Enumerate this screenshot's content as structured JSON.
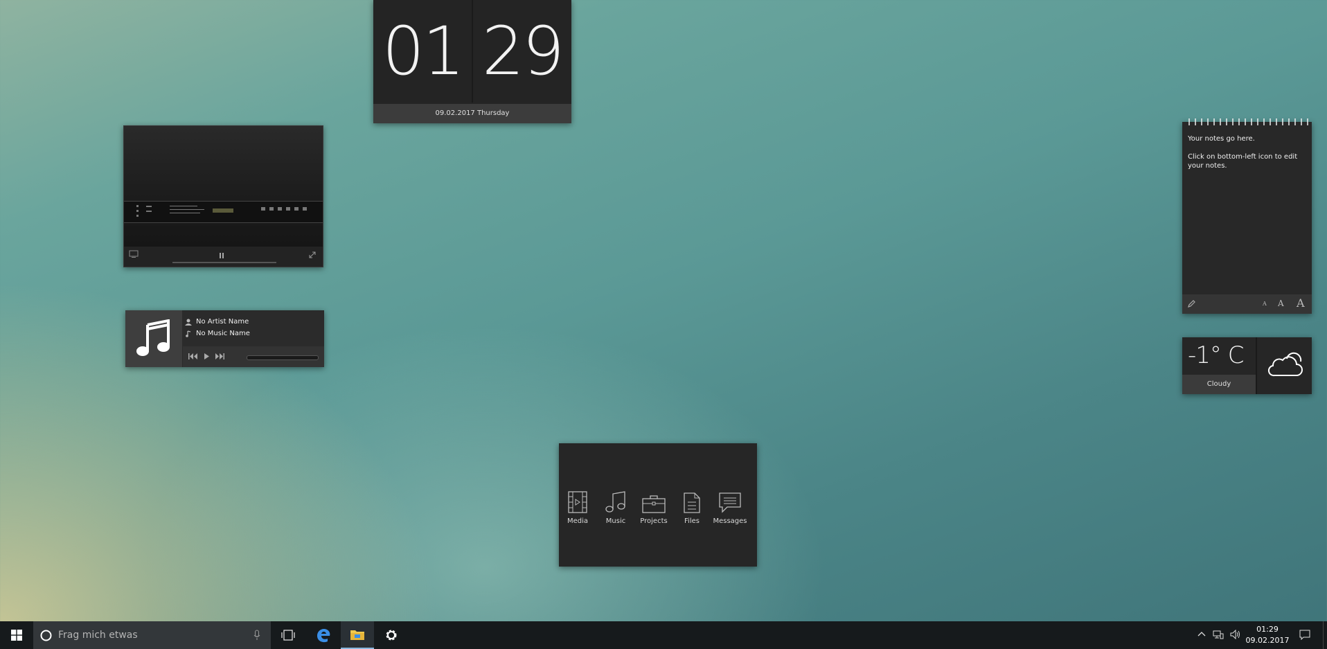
{
  "clock": {
    "hours": "01",
    "minutes": "29",
    "date": "09.02.2017 Thursday"
  },
  "music": {
    "artist": "No Artist Name",
    "title": "No Music Name"
  },
  "notes": {
    "line1": "Your notes go here.",
    "line2": "Click on bottom-left icon to edit your notes.",
    "font_small": "A",
    "font_medium": "A",
    "font_large": "A"
  },
  "weather": {
    "temperature": "-1° C",
    "condition": "Cloudy",
    "icon": "cloud-icon"
  },
  "launcher": {
    "items": [
      {
        "label": "Media",
        "icon": "film-icon"
      },
      {
        "label": "Music",
        "icon": "music-note-icon"
      },
      {
        "label": "Projects",
        "icon": "briefcase-icon"
      },
      {
        "label": "Files",
        "icon": "file-icon"
      },
      {
        "label": "Messages",
        "icon": "message-icon"
      }
    ]
  },
  "taskbar": {
    "search_placeholder": "Frag mich etwas",
    "apps": [
      "windows-start-icon",
      "task-view-icon",
      "edge-icon",
      "file-explorer-icon",
      "settings-icon"
    ],
    "tray_time": "01:29",
    "tray_date": "09.02.2017"
  },
  "colors": {
    "widget_bg": "#262626",
    "accent": "#3a8ee6",
    "explorer": "#f2c94c"
  }
}
